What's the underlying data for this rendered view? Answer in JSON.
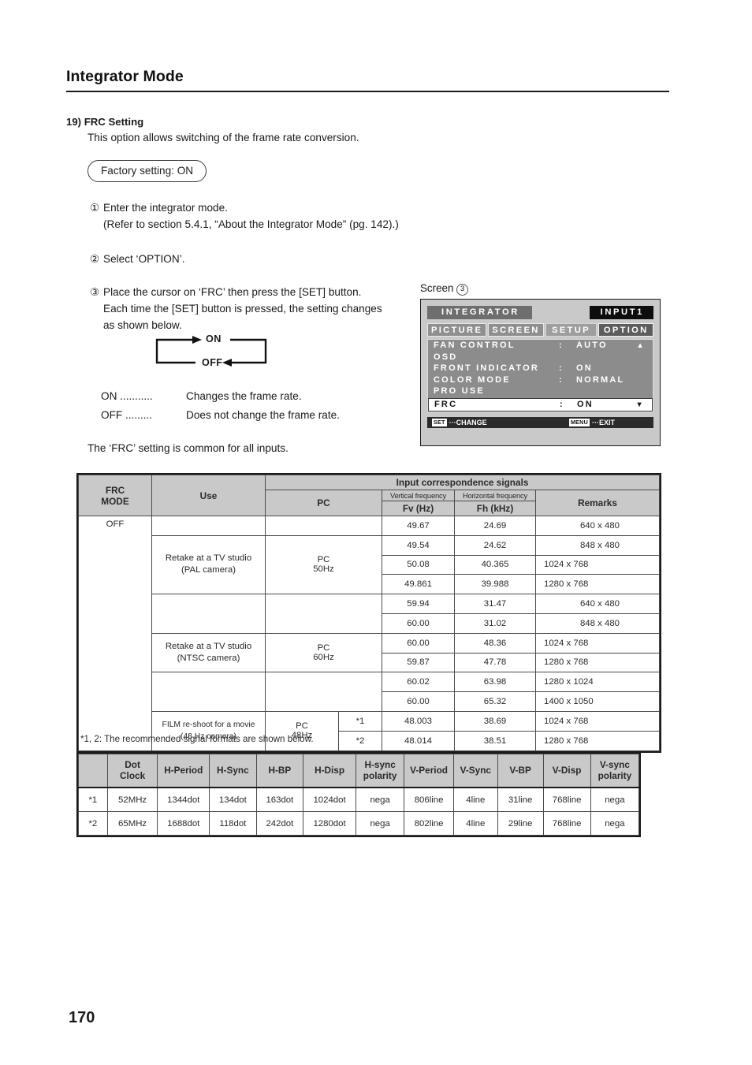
{
  "header": {
    "title": "Integrator Mode"
  },
  "section": {
    "number_title": "19) FRC Setting",
    "description": "This option allows switching of the frame rate conversion.",
    "factory_setting": "Factory setting: ON"
  },
  "steps": {
    "step1_line1": "Enter the integrator mode.",
    "step1_line2": "(Refer to section 5.4.1, “About the Integrator Mode” (pg. 142).)",
    "step2_line1": "Select ‘OPTION’.",
    "step3_line1": "Place the cursor on ‘FRC’ then press the [SET] button.",
    "step3_line2": "Each time the [SET] button is pressed, the setting changes",
    "step3_line3": "as shown below.",
    "num1": "①",
    "num2": "②",
    "num3": "③"
  },
  "cycle": {
    "on": "ON",
    "off": "OFF"
  },
  "legend": {
    "on_key": "ON ...........",
    "on_text": "Changes the frame rate.",
    "off_key": "OFF .........",
    "off_text": "Does not change the frame rate."
  },
  "common_note": "The ‘FRC’ setting is common for all inputs.",
  "screen": {
    "caption_prefix": "Screen",
    "caption_num": "3",
    "title": "INTEGRATOR",
    "input": "INPUT1",
    "tabs": [
      {
        "label": "PICTURE",
        "selected": false
      },
      {
        "label": "SCREEN",
        "selected": false
      },
      {
        "label": "SETUP",
        "selected": false
      },
      {
        "label": "OPTION",
        "selected": true
      }
    ],
    "rows": [
      {
        "label": "FAN  CONTROL",
        "colon": ":",
        "value": "AUTO",
        "caret": "▲",
        "selected": false
      },
      {
        "label": "OSD",
        "colon": "",
        "value": "",
        "caret": "",
        "selected": false
      },
      {
        "label": "FRONT   INDICATOR",
        "colon": ":",
        "value": "ON",
        "caret": "",
        "selected": false
      },
      {
        "label": "COLOR  MODE",
        "colon": ":",
        "value": "NORMAL",
        "caret": "",
        "selected": false
      },
      {
        "label": "PRO  USE",
        "colon": "",
        "value": "",
        "caret": "",
        "selected": false
      },
      {
        "label": "FRC",
        "colon": ":",
        "value": "ON",
        "caret": "▼",
        "selected": true
      }
    ],
    "footer": {
      "set_key": "SET",
      "set_action": "···CHANGE",
      "menu_key": "MENU",
      "menu_action": "···EXIT"
    }
  },
  "main_table": {
    "headers": {
      "frc_mode": "FRC\nMODE",
      "frc_mode_l1": "FRC",
      "frc_mode_l2": "MODE",
      "use": "Use",
      "input_signals": "Input correspondence signals",
      "pc": "PC",
      "vertical_frequency": "Vertical frequency",
      "horizontal_frequency": "Horizontal frequency",
      "fv": "Fv (Hz)",
      "fh": "Fh (kHz)",
      "remarks": "Remarks"
    },
    "frc_mode_value": "OFF",
    "groups": [
      {
        "use_l1": "Retake at a TV studio",
        "use_l2": "(PAL camera)",
        "pc_l1": "PC",
        "pc_l2": "50Hz",
        "rows": [
          {
            "star": "",
            "fv": "49.67",
            "fh": "24.69",
            "remarks": "640 x 480",
            "center": true
          },
          {
            "star": "",
            "fv": "49.54",
            "fh": "24.62",
            "remarks": "848 x 480",
            "center": true
          },
          {
            "star": "",
            "fv": "50.08",
            "fh": "40.365",
            "remarks": "1024 x 768",
            "center": false
          },
          {
            "star": "",
            "fv": "49.861",
            "fh": "39.988",
            "remarks": "1280 x 768",
            "center": false
          }
        ]
      },
      {
        "use_l1": "Retake at a TV studio",
        "use_l2": "(NTSC camera)",
        "pc_l1": "PC",
        "pc_l2": "60Hz",
        "rows": [
          {
            "star": "",
            "fv": "59.94",
            "fh": "31.47",
            "remarks": "640 x 480",
            "center": true
          },
          {
            "star": "",
            "fv": "60.00",
            "fh": "31.02",
            "remarks": "848 x 480",
            "center": true
          },
          {
            "star": "",
            "fv": "60.00",
            "fh": "48.36",
            "remarks": "1024 x 768",
            "center": false
          },
          {
            "star": "",
            "fv": "59.87",
            "fh": "47.78",
            "remarks": "1280 x 768",
            "center": false
          },
          {
            "star": "",
            "fv": "60.02",
            "fh": "63.98",
            "remarks": "1280 x 1024",
            "center": false
          },
          {
            "star": "",
            "fv": "60.00",
            "fh": "65.32",
            "remarks": "1400 x 1050",
            "center": false
          }
        ]
      },
      {
        "use_l1": "FILM re-shoot for a movie",
        "use_l2": "(48 Hz camera)",
        "pc_l1": "PC",
        "pc_l2": "48Hz",
        "rows": [
          {
            "star": "*1",
            "fv": "48.003",
            "fh": "38.69",
            "remarks": "1024 x 768",
            "center": false
          },
          {
            "star": "*2",
            "fv": "48.014",
            "fh": "38.51",
            "remarks": "1280 x 768",
            "center": false
          }
        ]
      }
    ]
  },
  "note": "*1, 2:  The recommended signal formats are shown below.",
  "signal_table": {
    "headers": [
      "",
      "Dot Clock",
      "H-Period",
      "H-Sync",
      "H-BP",
      "H-Disp",
      "H-sync\npolarity",
      "V-Period",
      "V-Sync",
      "V-BP",
      "V-Disp",
      "V-sync\npolarity"
    ],
    "headers_split": [
      {
        "l1": "",
        "l2": ""
      },
      {
        "l1": "Dot Clock",
        "l2": ""
      },
      {
        "l1": "H-Period",
        "l2": ""
      },
      {
        "l1": "H-Sync",
        "l2": ""
      },
      {
        "l1": "H-BP",
        "l2": ""
      },
      {
        "l1": "H-Disp",
        "l2": ""
      },
      {
        "l1": "H-sync",
        "l2": "polarity"
      },
      {
        "l1": "V-Period",
        "l2": ""
      },
      {
        "l1": "V-Sync",
        "l2": ""
      },
      {
        "l1": "V-BP",
        "l2": ""
      },
      {
        "l1": "V-Disp",
        "l2": ""
      },
      {
        "l1": "V-sync",
        "l2": "polarity"
      }
    ],
    "rows": [
      [
        "*1",
        "52MHz",
        "1344dot",
        "134dot",
        "163dot",
        "1024dot",
        "nega",
        "806line",
        "4line",
        "31line",
        "768line",
        "nega"
      ],
      [
        "*2",
        "65MHz",
        "1688dot",
        "118dot",
        "242dot",
        "1280dot",
        "nega",
        "802line",
        "4line",
        "29line",
        "768line",
        "nega"
      ]
    ]
  },
  "page_number": "170"
}
